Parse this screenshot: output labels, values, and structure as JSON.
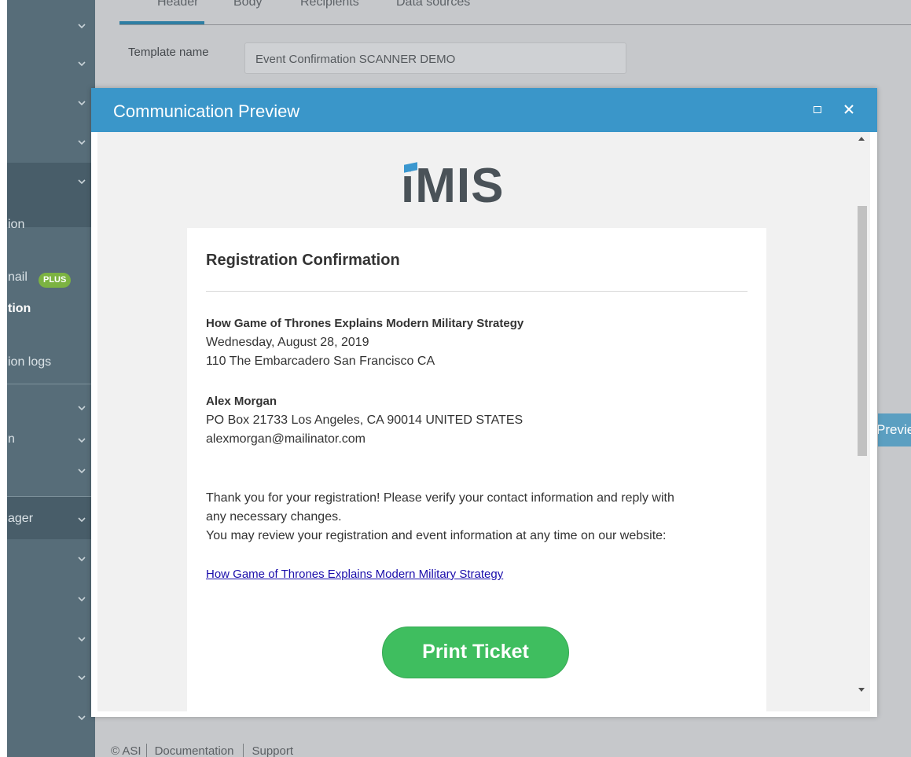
{
  "sidebar": {
    "items": [
      {
        "label": "ion"
      },
      {
        "label": "nail"
      },
      {
        "label": "tion"
      },
      {
        "label": "ion logs"
      },
      {
        "label": "n"
      },
      {
        "label": "ager"
      }
    ],
    "plus_badge": "PLUS"
  },
  "tabs": [
    {
      "label": "Header",
      "active": true
    },
    {
      "label": "Body"
    },
    {
      "label": "Recipients"
    },
    {
      "label": "Data sources"
    }
  ],
  "form": {
    "template_name_label": "Template name",
    "template_name_value": "Event Confirmation SCANNER DEMO"
  },
  "background_button": {
    "label": "Preview"
  },
  "footer": {
    "copyright": "© ASI",
    "documentation": "Documentation",
    "support": "Support"
  },
  "modal": {
    "title": "Communication Preview",
    "icons": {
      "maximize": "maximize-icon",
      "close": "close-icon"
    }
  },
  "email": {
    "logo_text": "iMIS",
    "heading": "Registration Confirmation",
    "event": {
      "name": "How Game of Thrones Explains Modern Military Strategy",
      "date": "Wednesday, August 28, 2019",
      "location": "110 The Embarcadero San Francisco CA"
    },
    "registrant": {
      "name": "Alex Morgan",
      "address": "PO Box 21733 Los Angeles, CA 90014 UNITED STATES",
      "email": "alexmorgan@mailinator.com"
    },
    "message_line1": "Thank you for your registration! Please verify your contact information and reply with",
    "message_line2": "any necessary changes.",
    "message_line3": "You may review your registration and event information at any time on our website:",
    "link_text": "How Game of Thrones Explains Modern Military Strategy",
    "button_label": "Print Ticket"
  },
  "colors": {
    "sidebar": "#576d79",
    "modal_header": "#3a96c9",
    "print_button": "#3fbe5f",
    "link": "#1a0dab"
  }
}
